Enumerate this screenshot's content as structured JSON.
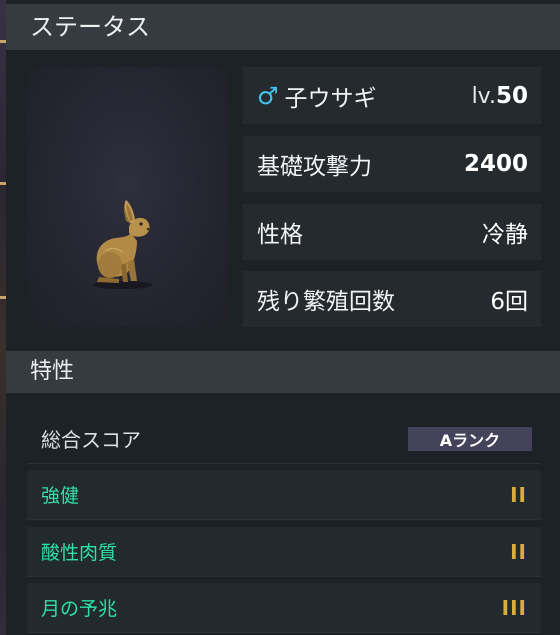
{
  "status_panel": {
    "title": "ステータス"
  },
  "stats": {
    "name_row": {
      "gender": "♂",
      "name": "子ウサギ",
      "level_prefix": "lv.",
      "level": "50"
    },
    "attack": {
      "label": "基礎攻撃力",
      "value": "2400"
    },
    "personality": {
      "label": "性格",
      "value": "冷静"
    },
    "breeding": {
      "label": "残り繁殖回数",
      "value": "6回"
    }
  },
  "traits_panel": {
    "title": "特性"
  },
  "traits": {
    "overall": {
      "label": "総合スコア",
      "badge": "Aランク"
    },
    "items": [
      {
        "name": "強健",
        "rank": "II"
      },
      {
        "name": "酸性肉質",
        "rank": "II"
      },
      {
        "name": "月の予兆",
        "rank": "III"
      }
    ]
  },
  "colors": {
    "trait_text": "#2ee0a6",
    "rank_gold": "#d8ad3a",
    "male_blue": "#3fc3ea",
    "badge_bg": "#45435c"
  },
  "icons": {
    "gender": "male-icon",
    "portrait": "rabbit-portrait"
  }
}
